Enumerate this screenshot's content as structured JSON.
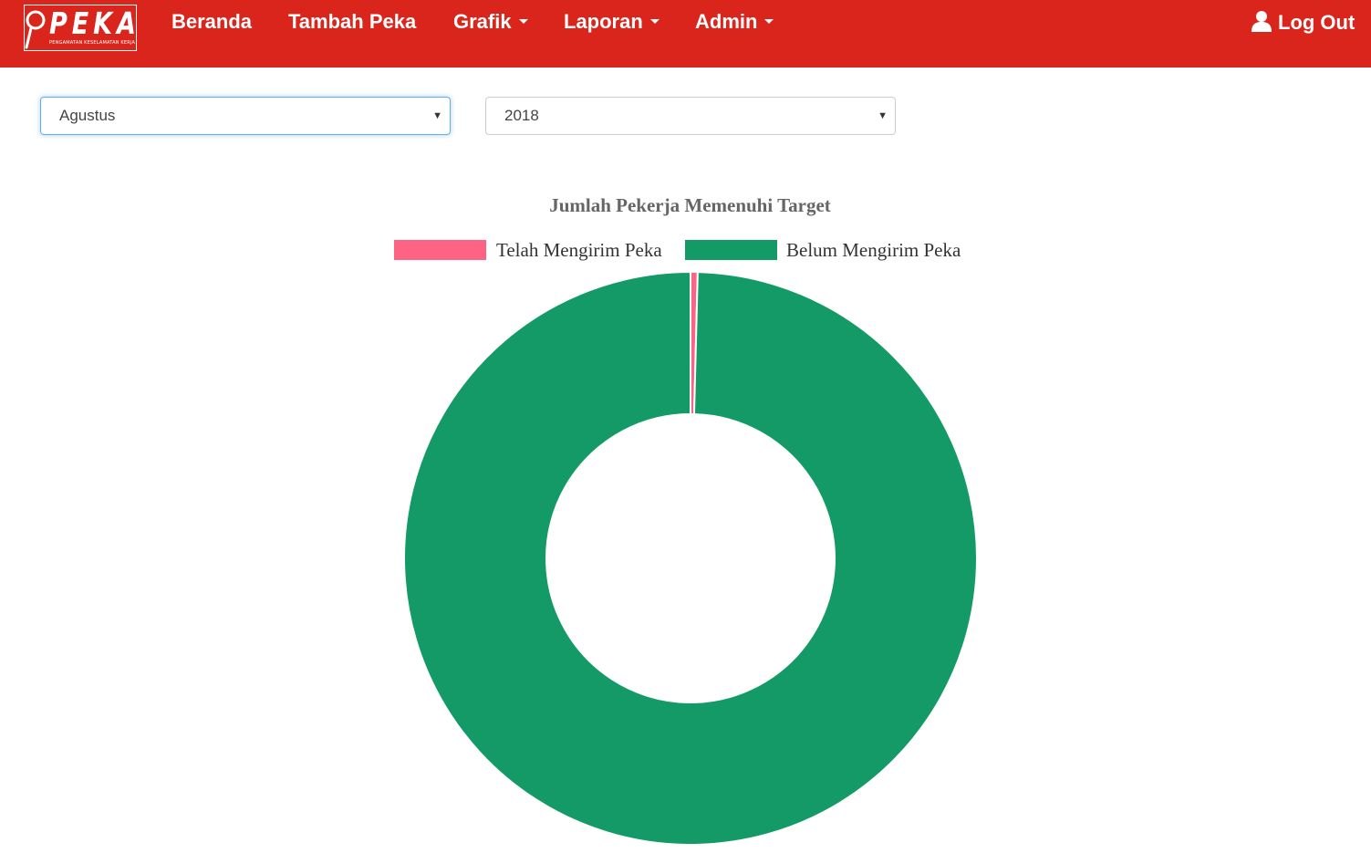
{
  "brand": {
    "name": "PEKA",
    "tagline": "PENGAMATAN KESELAMATAN KERJA"
  },
  "nav": {
    "items": [
      {
        "label": "Beranda",
        "dropdown": false
      },
      {
        "label": "Tambah Peka",
        "dropdown": false
      },
      {
        "label": "Grafik",
        "dropdown": true
      },
      {
        "label": "Laporan",
        "dropdown": true
      },
      {
        "label": "Admin",
        "dropdown": true
      }
    ],
    "logout_label": "Log Out",
    "bg_color": "#da251c"
  },
  "filters": {
    "month": "Agustus",
    "year": "2018"
  },
  "chart_data": {
    "type": "pie",
    "variant": "doughnut",
    "title": "Jumlah Pekerja Memenuhi Target",
    "legend_position": "top",
    "labels": [
      "Telah Mengirim Peka",
      "Belum Mengirim Peka"
    ],
    "values": [
      1,
      249
    ],
    "colors": [
      "#ff6384",
      "#149a67"
    ]
  }
}
